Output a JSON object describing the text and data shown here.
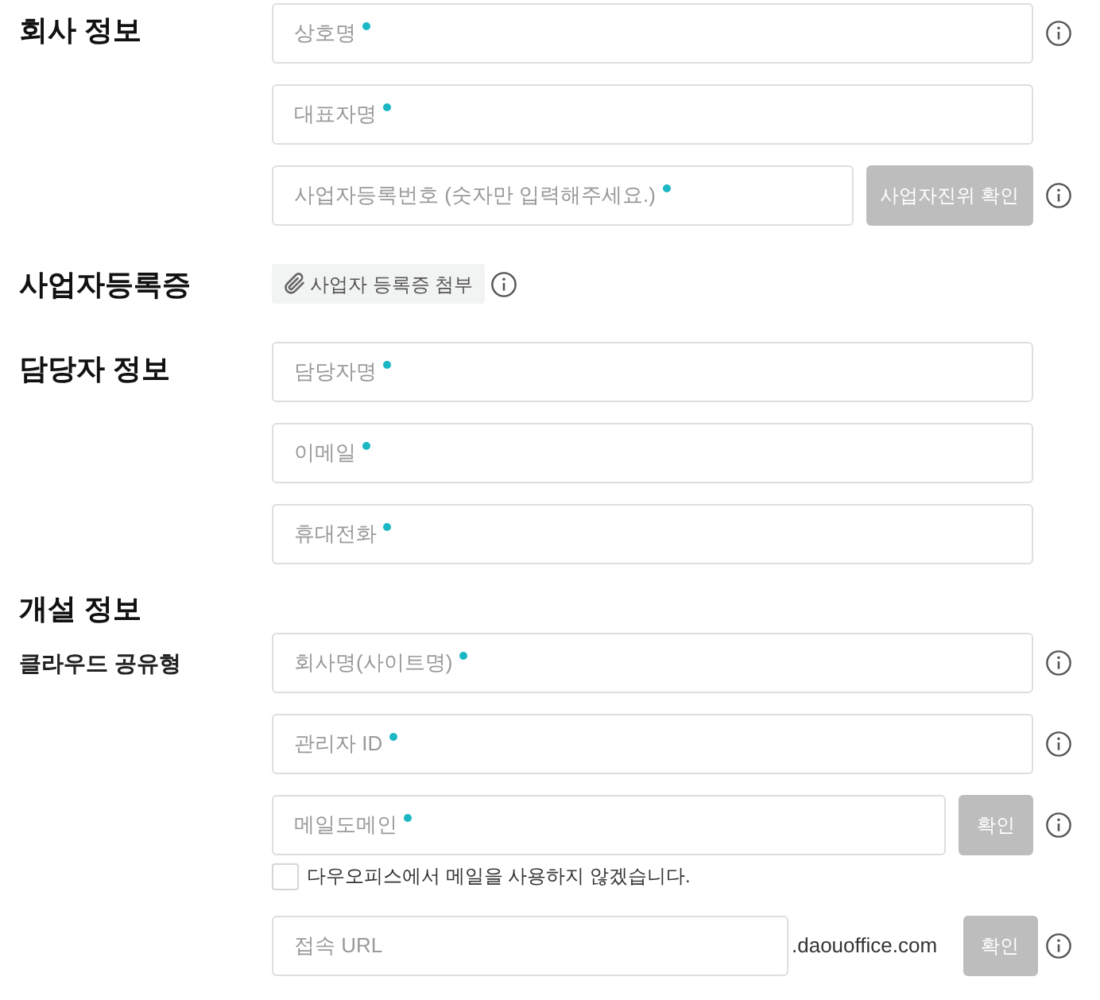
{
  "sections": [
    {
      "title": "회사 정보",
      "rows": [
        {
          "kind": "field",
          "placeholder": "상호명",
          "required": true,
          "info": true
        },
        {
          "kind": "field",
          "placeholder": "대표자명",
          "required": true,
          "info": false
        },
        {
          "kind": "field",
          "placeholder": "사업자등록번호 (숫자만 입력해주세요.)",
          "required": true,
          "button": {
            "label": "사업자진위 확인",
            "disabled": true
          },
          "info": true
        }
      ]
    },
    {
      "title": "사업자등록증",
      "rows": [
        {
          "kind": "attachment",
          "label": "사업자 등록증 첨부",
          "info": true
        }
      ]
    },
    {
      "title": "담당자 정보",
      "rows": [
        {
          "kind": "field",
          "placeholder": "담당자명",
          "required": true,
          "info": false
        },
        {
          "kind": "field",
          "placeholder": "이메일",
          "required": true,
          "info": false
        },
        {
          "kind": "field",
          "placeholder": "휴대전화",
          "required": true,
          "info": false
        }
      ]
    },
    {
      "title": "개설 정보",
      "subtitle": "클라우드 공유형",
      "rows": [
        {
          "kind": "field",
          "placeholder": "회사명(사이트명)",
          "required": true,
          "info": true
        },
        {
          "kind": "field",
          "placeholder": "관리자 ID",
          "required": true,
          "info": true
        },
        {
          "kind": "field",
          "placeholder": "메일도메인",
          "required": true,
          "button": {
            "label": "확인",
            "disabled": true
          },
          "info": true
        },
        {
          "kind": "checkbox",
          "label": "다우오피스에서 메일을 사용하지 않겠습니다.",
          "checked": false
        },
        {
          "kind": "field",
          "placeholder": "접속 URL",
          "required": false,
          "suffix": ".daouoffice.com",
          "button": {
            "label": "확인",
            "disabled": true
          },
          "info": true
        }
      ]
    }
  ]
}
